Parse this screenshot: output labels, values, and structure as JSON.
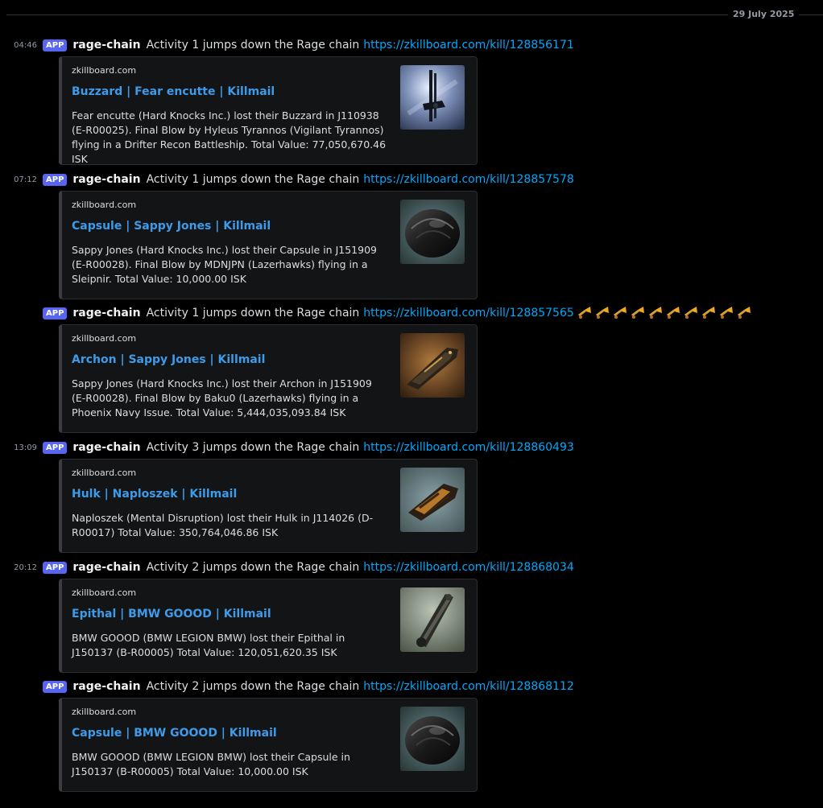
{
  "date_divider": "29 July 2025",
  "messages": [
    {
      "time": "04:46",
      "badge": "APP",
      "author": "rage-chain",
      "content": "Activity 1 jumps down the Rage chain",
      "link": "https://zkillboard.com/kill/128856171",
      "embed": {
        "provider": "zkillboard.com",
        "title": "Buzzard | Fear encutte | Killmail",
        "description": "Fear encutte (Hard Knocks Inc.) lost their Buzzard in J110938 (E-R00025). Final Blow by Hyleus Tyrannos (Vigilant Tyrannos) flying in a Drifter Recon Battleship. Total Value: 77,050,670.46 ISK",
        "thumbnail": "buzzard-ship-image"
      }
    },
    {
      "time": "07:12",
      "badge": "APP",
      "author": "rage-chain",
      "content": "Activity 1 jumps down the Rage chain",
      "link": "https://zkillboard.com/kill/128857578",
      "embed": {
        "provider": "zkillboard.com",
        "title": "Capsule | Sappy Jones | Killmail",
        "description": "Sappy Jones (Hard Knocks Inc.) lost their Capsule in J151909 (E-R00028). Final Blow by MDNJPN (Lazerhawks) flying in a Sleipnir. Total Value: 10,000.00 ISK",
        "thumbnail": "capsule-ship-image"
      }
    },
    {
      "time": "",
      "badge": "APP",
      "author": "rage-chain",
      "content": "Activity 1 jumps down the Rage chain",
      "link": "https://zkillboard.com/kill/128857565",
      "reactions": [
        "trumpet-emoji",
        "trumpet-emoji",
        "trumpet-emoji",
        "trumpet-emoji",
        "trumpet-emoji",
        "trumpet-emoji",
        "trumpet-emoji",
        "trumpet-emoji",
        "trumpet-emoji",
        "trumpet-emoji"
      ],
      "embed": {
        "provider": "zkillboard.com",
        "title": "Archon | Sappy Jones | Killmail",
        "description": "Sappy Jones (Hard Knocks Inc.) lost their Archon in J151909 (E-R00028). Final Blow by Baku0 (Lazerhawks) flying in a Phoenix Navy Issue. Total Value: 5,444,035,093.84 ISK",
        "thumbnail": "archon-ship-image"
      }
    },
    {
      "time": "13:09",
      "badge": "APP",
      "author": "rage-chain",
      "content": "Activity 3 jumps down the Rage chain",
      "link": "https://zkillboard.com/kill/128860493",
      "embed": {
        "provider": "zkillboard.com",
        "title": "Hulk | Naploszek | Killmail",
        "description": "Naploszek (Mental Disruption) lost their Hulk in J114026 (D-R00017) Total Value: 350,764,046.86 ISK",
        "thumbnail": "hulk-ship-image"
      }
    },
    {
      "time": "20:12",
      "badge": "APP",
      "author": "rage-chain",
      "content": "Activity 2 jumps down the Rage chain",
      "link": "https://zkillboard.com/kill/128868034",
      "embed": {
        "provider": "zkillboard.com",
        "title": "Epithal | BMW GOOOD | Killmail",
        "description": "BMW GOOOD (BMW LEGION BMW) lost their Epithal in J150137 (B-R00005) Total Value: 120,051,620.35 ISK",
        "thumbnail": "epithal-ship-image"
      }
    },
    {
      "time": "",
      "badge": "APP",
      "author": "rage-chain",
      "content": "Activity 2 jumps down the Rage chain",
      "link": "https://zkillboard.com/kill/128868112",
      "embed": {
        "provider": "zkillboard.com",
        "title": "Capsule | BMW GOOOD | Killmail",
        "description": "BMW GOOOD (BMW LEGION BMW) lost their Capsule in J150137 (B-R00005) Total Value: 10,000.00 ISK",
        "thumbnail": "capsule-ship-image"
      }
    }
  ]
}
